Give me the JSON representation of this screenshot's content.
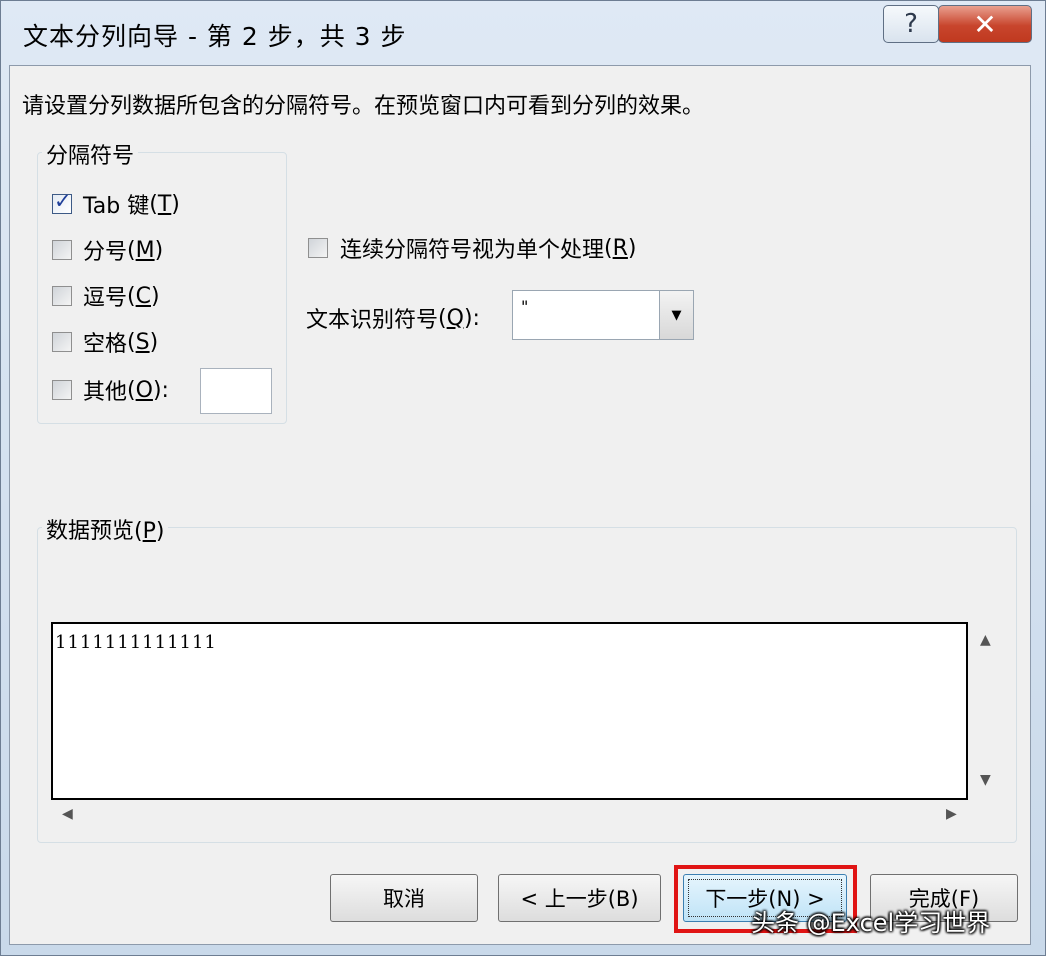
{
  "window": {
    "title": "文本分列向导 - 第 2 步，共 3 步",
    "help_symbol": "?",
    "close_symbol": "✕"
  },
  "instruction": "请设置分列数据所包含的分隔符号。在预览窗口内可看到分列的效果。",
  "delimiters": {
    "group_title": "分隔符号",
    "options": [
      {
        "label": "Tab 键",
        "accel": "(T)",
        "accel_key": "T",
        "checked": true
      },
      {
        "label": "分号",
        "accel": "(M)",
        "accel_key": "M",
        "checked": false
      },
      {
        "label": "逗号",
        "accel": "(C)",
        "accel_key": "C",
        "checked": false
      },
      {
        "label": "空格",
        "accel": "(S)",
        "accel_key": "S",
        "checked": false
      },
      {
        "label": "其他",
        "accel": "(O):",
        "accel_key": "O",
        "checked": false
      }
    ],
    "other_value": ""
  },
  "consecutive": {
    "label": "连续分隔符号视为单个处理",
    "accel": "(R)",
    "checked": false
  },
  "text_qualifier": {
    "label": "文本识别符号",
    "accel": "(Q):",
    "value": "\""
  },
  "preview": {
    "group_title": "数据预览",
    "accel": "(P)",
    "lines": [
      "1111111111111"
    ]
  },
  "buttons": {
    "cancel": "取消",
    "back": "< 上一步(B)",
    "next": "下一步(N) >",
    "finish": "完成(F)"
  },
  "watermark": "头条 @Excel学习世界",
  "colors": {
    "highlight": "#e01414",
    "check": "#1f3f9a"
  }
}
